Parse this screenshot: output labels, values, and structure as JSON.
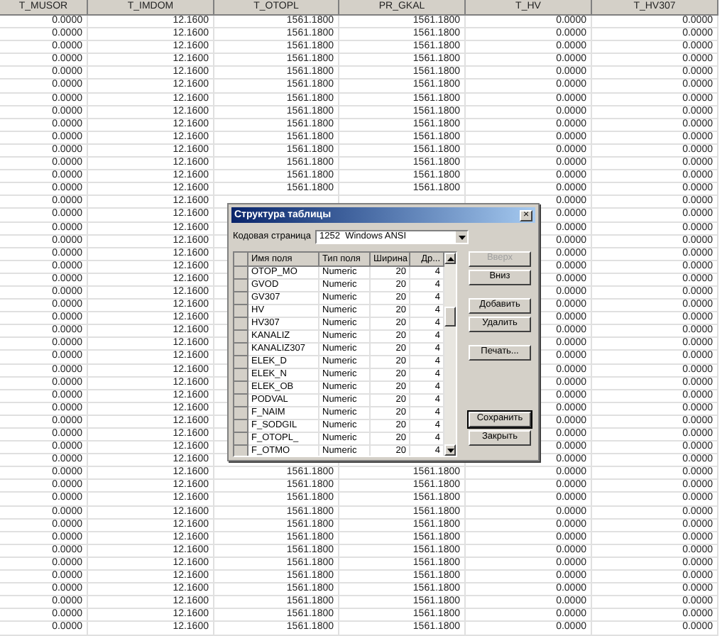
{
  "table": {
    "columns": [
      "T_MUSOR",
      "T_IMDOM",
      "T_OTOPL",
      "PR_GKAL",
      "T_HV",
      "T_HV307"
    ],
    "rows": [
      [
        "0.0000",
        "12.1600",
        "1561.1800",
        "1561.1800",
        "0.0000",
        "0.0000"
      ],
      [
        "0.0000",
        "12.1600",
        "1561.1800",
        "1561.1800",
        "0.0000",
        "0.0000"
      ],
      [
        "0.0000",
        "12.1600",
        "1561.1800",
        "1561.1800",
        "0.0000",
        "0.0000"
      ],
      [
        "0.0000",
        "12.1600",
        "1561.1800",
        "1561.1800",
        "0.0000",
        "0.0000"
      ],
      [
        "0.0000",
        "12.1600",
        "1561.1800",
        "1561.1800",
        "0.0000",
        "0.0000"
      ],
      [
        "0.0000",
        "12.1600",
        "1561.1800",
        "1561.1800",
        "0.0000",
        "0.0000"
      ],
      [
        "0.0000",
        "12.1600",
        "1561.1800",
        "1561.1800",
        "0.0000",
        "0.0000"
      ],
      [
        "0.0000",
        "12.1600",
        "1561.1800",
        "1561.1800",
        "0.0000",
        "0.0000"
      ],
      [
        "0.0000",
        "12.1600",
        "1561.1800",
        "1561.1800",
        "0.0000",
        "0.0000"
      ],
      [
        "0.0000",
        "12.1600",
        "1561.1800",
        "1561.1800",
        "0.0000",
        "0.0000"
      ],
      [
        "0.0000",
        "12.1600",
        "1561.1800",
        "1561.1800",
        "0.0000",
        "0.0000"
      ],
      [
        "0.0000",
        "12.1600",
        "1561.1800",
        "1561.1800",
        "0.0000",
        "0.0000"
      ],
      [
        "0.0000",
        "12.1600",
        "1561.1800",
        "1561.1800",
        "0.0000",
        "0.0000"
      ],
      [
        "0.0000",
        "12.1600",
        "1561.1800",
        "1561.1800",
        "0.0000",
        "0.0000"
      ],
      [
        "0.0000",
        "12.1600",
        null,
        null,
        "0.0000",
        "0.0000"
      ],
      [
        "0.0000",
        "12.1600",
        null,
        null,
        "0.0000",
        "0.0000"
      ],
      [
        "0.0000",
        "12.1600",
        null,
        null,
        "0.0000",
        "0.0000"
      ],
      [
        "0.0000",
        "12.1600",
        null,
        null,
        "0.0000",
        "0.0000"
      ],
      [
        "0.0000",
        "12.1600",
        null,
        null,
        "0.0000",
        "0.0000"
      ],
      [
        "0.0000",
        "12.1600",
        null,
        null,
        "0.0000",
        "0.0000"
      ],
      [
        "0.0000",
        "12.1600",
        null,
        null,
        "0.0000",
        "0.0000"
      ],
      [
        "0.0000",
        "12.1600",
        null,
        null,
        "0.0000",
        "0.0000"
      ],
      [
        "0.0000",
        "12.1600",
        null,
        null,
        "0.0000",
        "0.0000"
      ],
      [
        "0.0000",
        "12.1600",
        null,
        null,
        "0.0000",
        "0.0000"
      ],
      [
        "0.0000",
        "12.1600",
        null,
        null,
        "0.0000",
        "0.0000"
      ],
      [
        "0.0000",
        "12.1600",
        null,
        null,
        "0.0000",
        "0.0000"
      ],
      [
        "0.0000",
        "12.1600",
        null,
        null,
        "0.0000",
        "0.0000"
      ],
      [
        "0.0000",
        "12.1600",
        null,
        null,
        "0.0000",
        "0.0000"
      ],
      [
        "0.0000",
        "12.1600",
        null,
        null,
        "0.0000",
        "0.0000"
      ],
      [
        "0.0000",
        "12.1600",
        null,
        null,
        "0.0000",
        "0.0000"
      ],
      [
        "0.0000",
        "12.1600",
        null,
        null,
        "0.0000",
        "0.0000"
      ],
      [
        "0.0000",
        "12.1600",
        null,
        null,
        "0.0000",
        "0.0000"
      ],
      [
        "0.0000",
        "12.1600",
        null,
        null,
        "0.0000",
        "0.0000"
      ],
      [
        "0.0000",
        "12.1600",
        null,
        null,
        "0.0000",
        "0.0000"
      ],
      [
        "0.0000",
        "12.1600",
        null,
        null,
        "0.0000",
        "0.0000"
      ],
      [
        "0.0000",
        "12.1600",
        "1561.1800",
        "1561.1800",
        "0.0000",
        "0.0000"
      ],
      [
        "0.0000",
        "12.1600",
        "1561.1800",
        "1561.1800",
        "0.0000",
        "0.0000"
      ],
      [
        "0.0000",
        "12.1600",
        "1561.1800",
        "1561.1800",
        "0.0000",
        "0.0000"
      ],
      [
        "0.0000",
        "12.1600",
        "1561.1800",
        "1561.1800",
        "0.0000",
        "0.0000"
      ],
      [
        "0.0000",
        "12.1600",
        "1561.1800",
        "1561.1800",
        "0.0000",
        "0.0000"
      ],
      [
        "0.0000",
        "12.1600",
        "1561.1800",
        "1561.1800",
        "0.0000",
        "0.0000"
      ],
      [
        "0.0000",
        "12.1600",
        "1561.1800",
        "1561.1800",
        "0.0000",
        "0.0000"
      ],
      [
        "0.0000",
        "12.1600",
        "1561.1800",
        "1561.1800",
        "0.0000",
        "0.0000"
      ],
      [
        "0.0000",
        "12.1600",
        "1561.1800",
        "1561.1800",
        "0.0000",
        "0.0000"
      ],
      [
        "0.0000",
        "12.1600",
        "1561.1800",
        "1561.1800",
        "0.0000",
        "0.0000"
      ],
      [
        "0.0000",
        "12.1600",
        "1561.1800",
        "1561.1800",
        "0.0000",
        "0.0000"
      ],
      [
        "0.0000",
        "12.1600",
        "1561.1800",
        "1561.1800",
        "0.0000",
        "0.0000"
      ],
      [
        "0.0000",
        "12.1600",
        "1561.1800",
        "1561.1800",
        "0.0000",
        "0.0000"
      ]
    ]
  },
  "dialog": {
    "title": "Структура таблицы",
    "close": "×",
    "codepage": {
      "label": "Кодовая страница",
      "value": "1252  Windows ANSI"
    },
    "fields": {
      "columns": [
        "Имя поля",
        "Тип поля",
        "Ширина",
        "Др..."
      ],
      "rows": [
        [
          "OTOP_MO",
          "Numeric",
          "20",
          "4"
        ],
        [
          "GVOD",
          "Numeric",
          "20",
          "4"
        ],
        [
          "GV307",
          "Numeric",
          "20",
          "4"
        ],
        [
          "HV",
          "Numeric",
          "20",
          "4"
        ],
        [
          "HV307",
          "Numeric",
          "20",
          "4"
        ],
        [
          "KANALIZ",
          "Numeric",
          "20",
          "4"
        ],
        [
          "KANALIZ307",
          "Numeric",
          "20",
          "4"
        ],
        [
          "ELEK_D",
          "Numeric",
          "20",
          "4"
        ],
        [
          "ELEK_N",
          "Numeric",
          "20",
          "4"
        ],
        [
          "ELEK_OB",
          "Numeric",
          "20",
          "4"
        ],
        [
          "PODVAL",
          "Numeric",
          "20",
          "4"
        ],
        [
          "F_NAIM",
          "Numeric",
          "20",
          "4"
        ],
        [
          "F_SODGIL",
          "Numeric",
          "20",
          "4"
        ],
        [
          "F_OTOPL_",
          "Numeric",
          "20",
          "4"
        ],
        [
          "F_OTMO",
          "Numeric",
          "20",
          "4"
        ]
      ]
    },
    "button_groups": [
      [
        {
          "label": "Вверх",
          "disabled": true,
          "default": false
        },
        {
          "label": "Вниз",
          "disabled": false,
          "default": false
        }
      ],
      [
        {
          "label": "Добавить",
          "disabled": false,
          "default": false
        },
        {
          "label": "Удалить",
          "disabled": false,
          "default": false
        }
      ],
      [
        {
          "label": "Печать...",
          "disabled": false,
          "default": false
        }
      ],
      [
        {
          "label": "Сохранить",
          "disabled": false,
          "default": true
        },
        {
          "label": "Закрыть",
          "disabled": false,
          "default": false
        }
      ]
    ]
  }
}
